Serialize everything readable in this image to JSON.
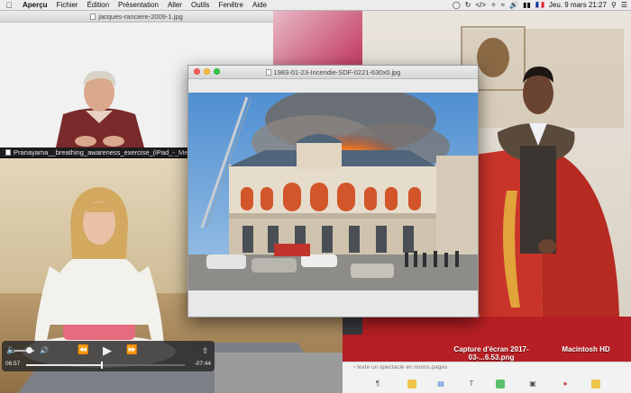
{
  "menubar": {
    "app": "Aperçu",
    "items": [
      "Fichier",
      "Édition",
      "Présentation",
      "Aller",
      "Outils",
      "Fenêtre",
      "Aide"
    ],
    "status": {
      "input_flag": "🇫🇷",
      "clock": "Jeu. 9 mars  21:27"
    }
  },
  "windows": {
    "ranciere": {
      "title": "jacques-ranciere-2009-1.jpg"
    },
    "yoga": {
      "title": "Pranayama__breathing_awareness_exercise_(iPad_-_Medi",
      "controls": {
        "time_current": "06:57",
        "time_remaining": "-07:44",
        "progress": 0.48,
        "volume": 0.75
      }
    },
    "fire": {
      "title": "1983-01-23-Incendie-SDF-0221-630x0.jpg"
    },
    "toolbar": {
      "hint_text": "texte un spectacle en moins.pages"
    }
  },
  "desktop_icons": [
    {
      "label": "Capture d'écran 2017-03-...6.53.png"
    },
    {
      "label": "Macintosh HD"
    }
  ],
  "colors": {
    "close": "#fc605b",
    "minimize": "#fdbc40",
    "maximize": "#34c84a"
  }
}
